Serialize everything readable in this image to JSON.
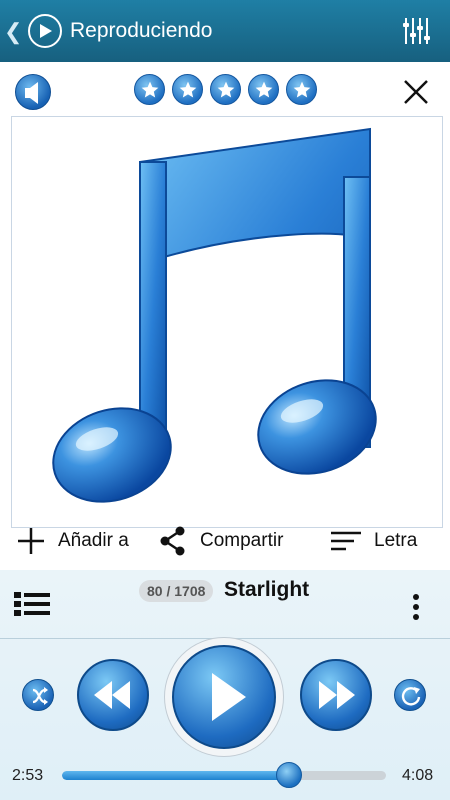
{
  "topbar": {
    "title": "Reproduciendo",
    "icons": [
      "back-chevron-icon",
      "play-circle-icon",
      "equalizer-icon"
    ]
  },
  "rating": {
    "stars_filled": 5,
    "stars_total": 5
  },
  "actions": {
    "add_label": "Añadir a",
    "share_label": "Compartir",
    "lyrics_label": "Letra"
  },
  "track": {
    "counter": "80 / 1708",
    "title": "Starlight",
    "elapsed": "2:53",
    "duration": "4:08",
    "progress": 0.7
  },
  "colors": {
    "topbar": "#1f7fa5",
    "accent": "#1e6bc1",
    "player_bg": "#e4f1f8"
  }
}
